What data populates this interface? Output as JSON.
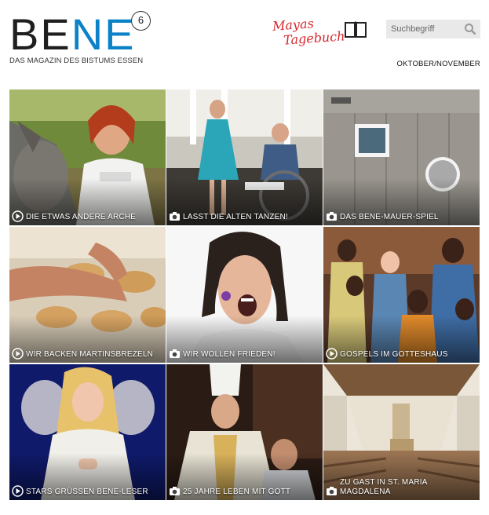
{
  "header": {
    "logo": {
      "part1": "BE",
      "part2": "NE",
      "badge": "6",
      "subtitle": "DAS MAGAZIN DES BISTUMS ESSEN"
    },
    "diary": {
      "line1": "Mayas",
      "line2": "Tagebuch"
    },
    "search": {
      "placeholder": "Suchbegriff"
    },
    "issue": "OKTOBER/NOVEMBER"
  },
  "colors": {
    "accent": "#0b82c8",
    "diary_red": "#d8262f",
    "search_bg": "#e9e9e9"
  },
  "tiles": [
    {
      "title": "DIE ETWAS ANDERE ARCHE",
      "icon": "play-icon"
    },
    {
      "title": "LASST DIE ALTEN TANZEN!",
      "icon": "camera-icon"
    },
    {
      "title": "DAS BENE-MAUER-SPIEL",
      "icon": "camera-icon"
    },
    {
      "title": "WIR BACKEN MARTINSBREZELN",
      "icon": "play-icon"
    },
    {
      "title": "WIR WOLLEN FRIEDEN!",
      "icon": "camera-icon"
    },
    {
      "title": "GOSPELS IM GOTTESHAUS",
      "icon": "play-icon"
    },
    {
      "title": "STARS GRÜSSEN BENE-LESER",
      "icon": "play-icon"
    },
    {
      "title": "25 JAHRE LEBEN MIT GOTT",
      "icon": "camera-icon"
    },
    {
      "title": "ZU GAST IN ST. MARIA MAGDALENA",
      "icon": "camera-icon"
    }
  ]
}
